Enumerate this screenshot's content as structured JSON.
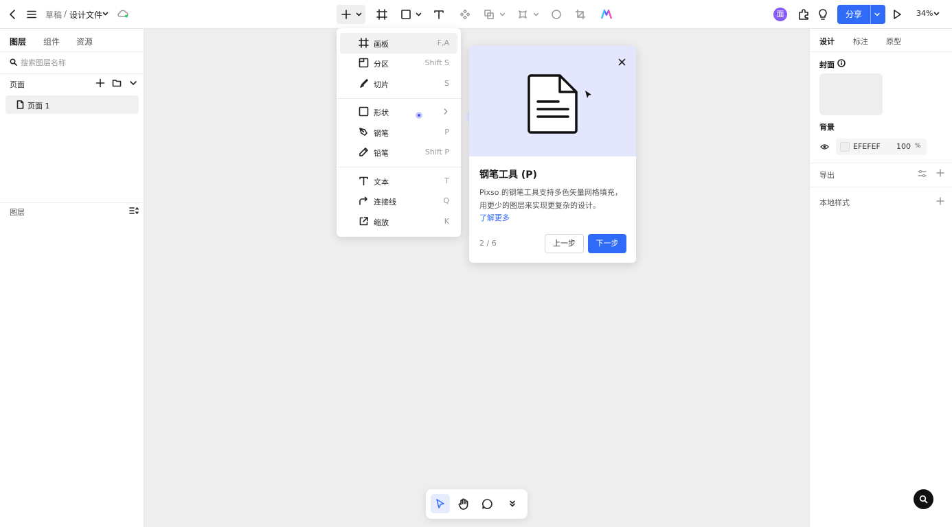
{
  "topbar": {
    "breadcrumb_parent": "草稿",
    "breadcrumb_sep": "/",
    "file_name": "设计文件",
    "avatar_initial": "面",
    "share_label": "分享",
    "zoom": "34%"
  },
  "left_panel": {
    "tabs": [
      "图层",
      "组件",
      "资源"
    ],
    "search_placeholder": "搜索图层名称",
    "pages_header": "页面",
    "page_item": "页面 1",
    "layers_header": "图层"
  },
  "tool_menu": {
    "groups": [
      [
        {
          "label": "画板",
          "key": "F,A",
          "icon": "frame-icon"
        },
        {
          "label": "分区",
          "key": "Shift S",
          "icon": "section-icon"
        },
        {
          "label": "切片",
          "key": "S",
          "icon": "slice-icon"
        }
      ],
      [
        {
          "label": "形状",
          "key": "",
          "icon": "shape-icon"
        },
        {
          "label": "钢笔",
          "key": "P",
          "icon": "pen-icon"
        },
        {
          "label": "铅笔",
          "key": "Shift P",
          "icon": "pencil-icon"
        }
      ],
      [
        {
          "label": "文本",
          "key": "T",
          "icon": "text-icon"
        },
        {
          "label": "连接线",
          "key": "Q",
          "icon": "connector-icon"
        },
        {
          "label": "缩放",
          "key": "K",
          "icon": "scale-icon"
        }
      ]
    ]
  },
  "tour": {
    "title": "钢笔工具 (P)",
    "body": "Pixso 的钢笔工具支持多色矢量网格填充，用更少的图层来实现更复杂的设计。",
    "link": "了解更多",
    "step": "2 / 6",
    "prev_label": "上一步",
    "next_label": "下一步"
  },
  "right_panel": {
    "tabs": [
      "设计",
      "标注",
      "原型"
    ],
    "cover_label": "封面",
    "background_label": "背景",
    "bg_hex": "EFEFEF",
    "bg_opacity": "100",
    "bg_opacity_unit": "%",
    "export_label": "导出",
    "local_styles_label": "本地样式"
  },
  "colors": {
    "accent": "#2f6bf7",
    "canvas": "#eeeeee",
    "tour_hero": "#e3e6fd",
    "avatar": "#8a5cf6"
  }
}
